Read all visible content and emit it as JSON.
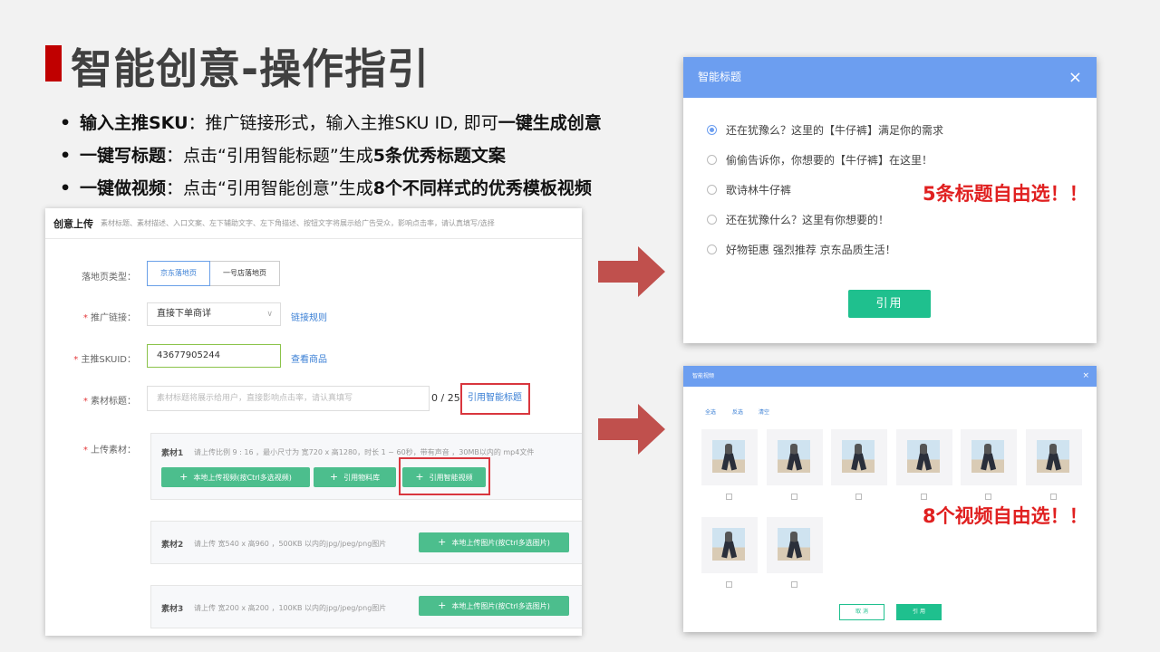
{
  "slide": {
    "title": "智能创意-操作指引",
    "bullets": [
      {
        "bold1": "输入主推SKU",
        "text1": "：推广链接形式，输入主推SKU ID, 即可",
        "bold2": "一键生成创意",
        "text2": ""
      },
      {
        "bold1": "一键写标题",
        "text1": "：点击“引用智能标题”生成",
        "bold2": "5条优秀标题文案",
        "text2": ""
      },
      {
        "bold1": "一键做视频",
        "text1": "：点击“引用智能创意”生成",
        "bold2": "8个不同样式的优秀模板视频",
        "text2": ""
      }
    ]
  },
  "form": {
    "header_title": "创意上传",
    "header_hint": "素材标题、素材描述、入口文案、左下辅助文字、左下角描述、按钮文字将展示给广告受众，影响点击率，请认真填写/选择",
    "landing_label": "落地页类型：",
    "landing_options": [
      "京东落地页",
      "一号店落地页"
    ],
    "promo_label": "推广链接：",
    "promo_value": "直接下单商详",
    "promo_link": "链接规则",
    "sku_label": "主推SKUID：",
    "sku_value": "43677905244",
    "sku_link": "查看商品",
    "title_label": "素材标题：",
    "title_placeholder": "素材标题将展示给用户，直接影响点击率，请认真填写",
    "title_counter": "0 / 25",
    "title_ref_link": "引用智能标题",
    "upload_label": "上传素材：",
    "materials": [
      {
        "name": "素材1",
        "hint": "请上传比例 9 : 16 ，最小尺寸为 宽720 x 高1280，时长 1 ~ 60秒，带有声音 ，30MB以内的 mp4文件",
        "buttons": [
          "本地上传视频(按Ctrl多选视频)",
          "引用物料库",
          "引用智能视频"
        ]
      },
      {
        "name": "素材2",
        "hint": "请上传 宽540 x 高960 ，500KB 以内的jpg/jpeg/png图片",
        "buttons": [
          "本地上传图片(按Ctrl多选图片)"
        ]
      },
      {
        "name": "素材3",
        "hint": "请上传 宽200 x 高200 ，100KB 以内的jpg/jpeg/png图片",
        "buttons": [
          "本地上传图片(按Ctrl多选图片)"
        ]
      }
    ]
  },
  "title_dialog": {
    "title": "智能标题",
    "close": "×",
    "options": [
      "还在犹豫么？这里的【牛仔裤】满足你的需求",
      "偷偷告诉你，你想要的【牛仔裤】在这里！",
      "歌诗林牛仔裤",
      "还在犹豫什么？这里有你想要的！",
      "好物钜惠 强烈推荐 京东品质生活！"
    ],
    "selected_index": 0,
    "use_button": "引用",
    "note": "5条标题自由选！！"
  },
  "video_dialog": {
    "title": "智能视频",
    "close": "×",
    "links": [
      "全选",
      "反选",
      "清空"
    ],
    "video_count": 8,
    "cancel_button": "取 消",
    "ok_button": "引 用",
    "note": "8个视频自由选！！"
  },
  "colors": {
    "accent_red": "#c00000",
    "note_red": "#e02020",
    "dialog_blue": "#6c9ef0",
    "green": "#1fc08e",
    "arrow": "#c0504d"
  }
}
